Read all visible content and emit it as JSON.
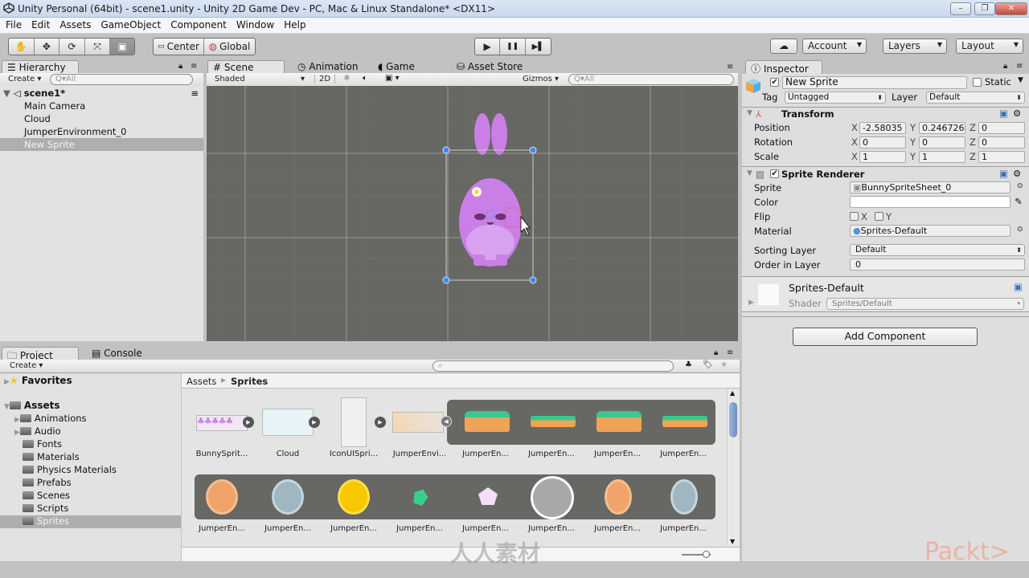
{
  "window": {
    "title": "Unity Personal (64bit) - scene1.unity - Unity 2D Game Dev - PC, Mac & Linux Standalone* <DX11>",
    "minimize": "–",
    "restore": "❐",
    "close": "✕"
  },
  "menu": [
    "File",
    "Edit",
    "Assets",
    "GameObject",
    "Component",
    "Window",
    "Help"
  ],
  "toolbar": {
    "tools": [
      "hand-tool",
      "move-tool",
      "rotate-tool",
      "scale-tool",
      "rect-tool"
    ],
    "pivot": "Center",
    "space": "Global",
    "play": "▶",
    "pause": "❚❚",
    "step": "▶▌",
    "cloud": "☁",
    "account": "Account",
    "layers": "Layers",
    "layout": "Layout"
  },
  "hierarchy": {
    "tab": "Hierarchy",
    "create": "Create",
    "search_placeholder": "Q▾All",
    "scene": "scene1*",
    "items": [
      "Main Camera",
      "Cloud",
      "JumperEnvironment_0",
      "New Sprite"
    ],
    "selected": "New Sprite"
  },
  "scene": {
    "tabs": [
      "Scene",
      "Animation",
      "Game",
      "Asset Store"
    ],
    "active_tab": "Scene",
    "shading": "Shaded",
    "mode_2d": "2D",
    "gizmos": "Gizmos",
    "search_placeholder": "Q▾All"
  },
  "inspector": {
    "tab": "Inspector",
    "object_name": "New Sprite",
    "active": true,
    "static_label": "Static",
    "tag_label": "Tag",
    "tag": "Untagged",
    "layer_label": "Layer",
    "layer": "Default",
    "transform": {
      "title": "Transform",
      "rows": [
        {
          "label": "Position",
          "x": "-2.58035",
          "y": "0.246726",
          "z": "0"
        },
        {
          "label": "Rotation",
          "x": "0",
          "y": "0",
          "z": "0"
        },
        {
          "label": "Scale",
          "x": "1",
          "y": "1",
          "z": "1"
        }
      ]
    },
    "sprite_renderer": {
      "title": "Sprite Renderer",
      "sprite_label": "Sprite",
      "sprite": "BunnySpriteSheet_0",
      "color_label": "Color",
      "flip_label": "Flip",
      "flip_x": "X",
      "flip_y": "Y",
      "material_label": "Material",
      "material": "Sprites-Default",
      "sorting_layer_label": "Sorting Layer",
      "sorting_layer": "Default",
      "order_label": "Order in Layer",
      "order": "0"
    },
    "material_section": {
      "name": "Sprites-Default",
      "shader_label": "Shader",
      "shader": "Sprites/Default"
    },
    "add_component": "Add Component"
  },
  "project": {
    "tabs": [
      "Project",
      "Console"
    ],
    "create": "Create",
    "favorites": "Favorites",
    "assets": "Assets",
    "folders": [
      "Animations",
      "Audio",
      "Fonts",
      "Materials",
      "Physics Materials",
      "Prefabs",
      "Scenes",
      "Scripts",
      "Sprites"
    ],
    "selected_folder": "Sprites",
    "breadcrumb": [
      "Assets",
      "Sprites"
    ],
    "row1": [
      "BunnySprit...",
      "Cloud",
      "IconUISpri...",
      "JumperEnvi...",
      "JumperEn...",
      "JumperEn...",
      "JumperEn...",
      "JumperEn..."
    ],
    "row2": [
      "JumperEn...",
      "JumperEn...",
      "JumperEn...",
      "JumperEn...",
      "JumperEn...",
      "JumperEn...",
      "JumperEn...",
      "JumperEn..."
    ]
  },
  "watermark": {
    "left": "人人素材",
    "right": "Packt>"
  }
}
